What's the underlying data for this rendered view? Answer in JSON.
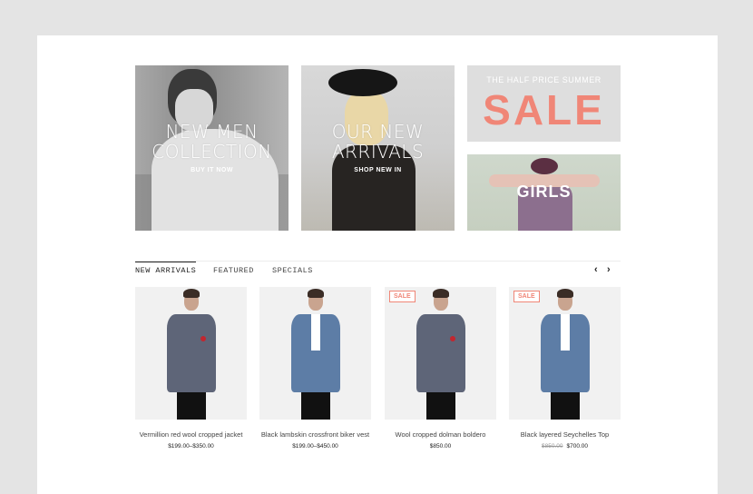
{
  "banners": {
    "men": {
      "title": "NEW MEN\nCOLLECTION",
      "cta": "BUY IT NOW"
    },
    "arrivals": {
      "title": "OUR NEW\nARRIVALS",
      "cta": "SHOP NEW IN"
    },
    "sale": {
      "top": "THE HALF PRICE SUMMER",
      "big": "SALE"
    },
    "girls": {
      "title": "GIRLS"
    }
  },
  "tabs": [
    "NEW ARRIVALS",
    "FEATURED",
    "SPECIALS"
  ],
  "carousel": {
    "prev_icon": "chevron-left-icon",
    "next_icon": "chevron-right-icon"
  },
  "badge": "SALE",
  "products": [
    {
      "name": "Vermillion red wool cropped jacket",
      "price": "$199.00–$350.00",
      "old_price": "",
      "sale": false
    },
    {
      "name": "Black lambskin crossfront biker vest",
      "price": "$199.00–$450.00",
      "old_price": "",
      "sale": false
    },
    {
      "name": "Wool cropped dolman boldero",
      "price": "$850.00",
      "old_price": "",
      "sale": true
    },
    {
      "name": "Black layered Seychelles Top",
      "price": "$700.00",
      "old_price": "$850.00",
      "sale": true
    }
  ],
  "colors": {
    "accent": "#f08677",
    "background": "#e4e4e4"
  }
}
